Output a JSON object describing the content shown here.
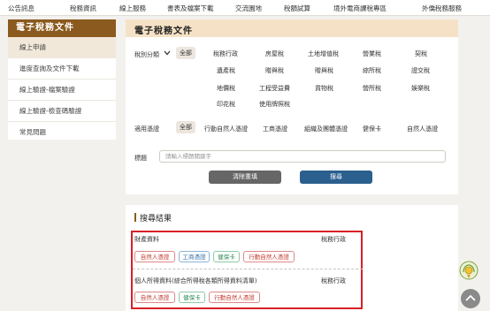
{
  "nav": {
    "items": [
      "公告訊息",
      "稅務資訊",
      "線上服務",
      "書表及檔案下載",
      "交流園地",
      "稅額試算",
      "境外電商課稅專區",
      "外僑稅務服務"
    ]
  },
  "sidebar": {
    "title": "電子稅務文件",
    "items": [
      "線上申請",
      "進度查詢及文件下載",
      "線上驗證-檔案驗證",
      "線上驗證-檢查碼驗證",
      "常見問題"
    ]
  },
  "main": {
    "title": "電子稅務文件",
    "tax_category_label": "稅別分類",
    "tax_all": "全部",
    "tax_options": [
      "稅務行政",
      "房屋稅",
      "土地增值稅",
      "營業稅",
      "契稅",
      "遺產稅",
      "贈與稅",
      "贈與稅",
      "綜所稅",
      "證交稅",
      "地價稅",
      "工程受益費",
      "貨物稅",
      "營所稅",
      "娛樂稅",
      "印花稅",
      "使用牌照稅"
    ],
    "cert_label": "適用憑證",
    "cert_all": "全部",
    "cert_options": [
      "行動自然人憑證",
      "工商憑證",
      "組織及團體憑證",
      "健保卡",
      "自然人憑證"
    ],
    "keyword_label": "標題",
    "keyword_placeholder": "請輸入標題關鍵字",
    "clear_label": "清除重填",
    "search_label": "搜尋"
  },
  "results": {
    "title": "搜尋結果",
    "items": [
      {
        "name": "財產資料",
        "category": "稅務行政",
        "tags": [
          "自然人憑證",
          "工商憑證",
          "健保卡",
          "行動自然人憑證"
        ]
      },
      {
        "name": "個人所得資料(綜合所得稅各類所得資料清單)",
        "category": "稅務行政",
        "tags": [
          "自然人憑證",
          "健保卡",
          "行動自然人憑證"
        ]
      }
    ]
  },
  "colors": {
    "brand": "#8b5a1e",
    "header_band": "#f5e2c6",
    "search_button": "#2a5f8e",
    "clear_button": "#666666",
    "highlight_box": "#d91f26"
  },
  "icons": {
    "dropdown": "chevron-down-icon",
    "badge": "award-badge-icon",
    "top": "arrow-up-icon"
  }
}
